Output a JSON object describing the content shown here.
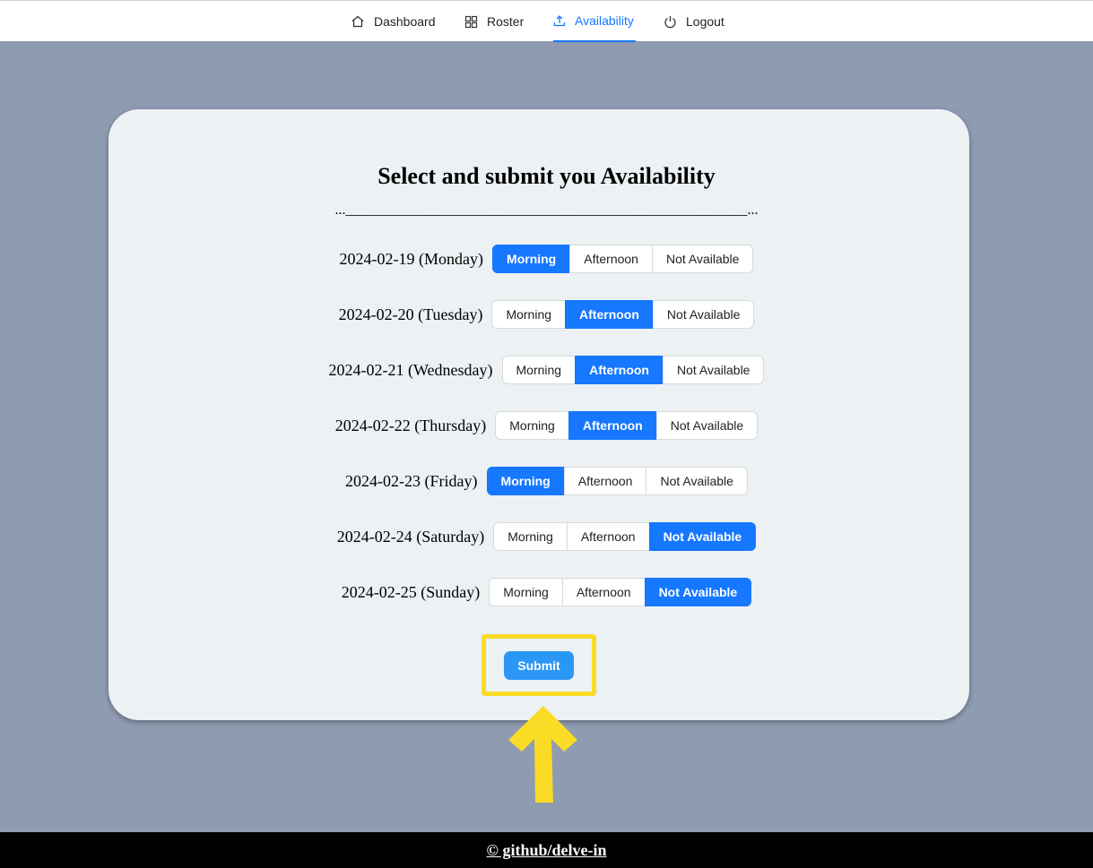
{
  "nav": {
    "items": [
      {
        "label": "Dashboard",
        "icon": "home-icon"
      },
      {
        "label": "Roster",
        "icon": "grid-icon"
      },
      {
        "label": "Availability",
        "icon": "upload-icon"
      },
      {
        "label": "Logout",
        "icon": "power-icon"
      }
    ],
    "active": "Availability",
    "accent_color": "#1677ff"
  },
  "form": {
    "title": "Select and submit you Availability",
    "divider": "...________________________________________________________...",
    "options": [
      "Morning",
      "Afternoon",
      "Not Available"
    ],
    "rows": [
      {
        "date": "2024-02-19 (Monday)",
        "selected": "Morning"
      },
      {
        "date": "2024-02-20 (Tuesday)",
        "selected": "Afternoon"
      },
      {
        "date": "2024-02-21 (Wednesday)",
        "selected": "Afternoon"
      },
      {
        "date": "2024-02-22 (Thursday)",
        "selected": "Afternoon"
      },
      {
        "date": "2024-02-23 (Friday)",
        "selected": "Morning"
      },
      {
        "date": "2024-02-24 (Saturday)",
        "selected": "Not Available"
      },
      {
        "date": "2024-02-25 (Sunday)",
        "selected": "Not Available"
      }
    ],
    "submit_label": "Submit"
  },
  "annotation": {
    "highlight_color": "#fadb25"
  },
  "footer": {
    "text": "© github/delve-in"
  }
}
